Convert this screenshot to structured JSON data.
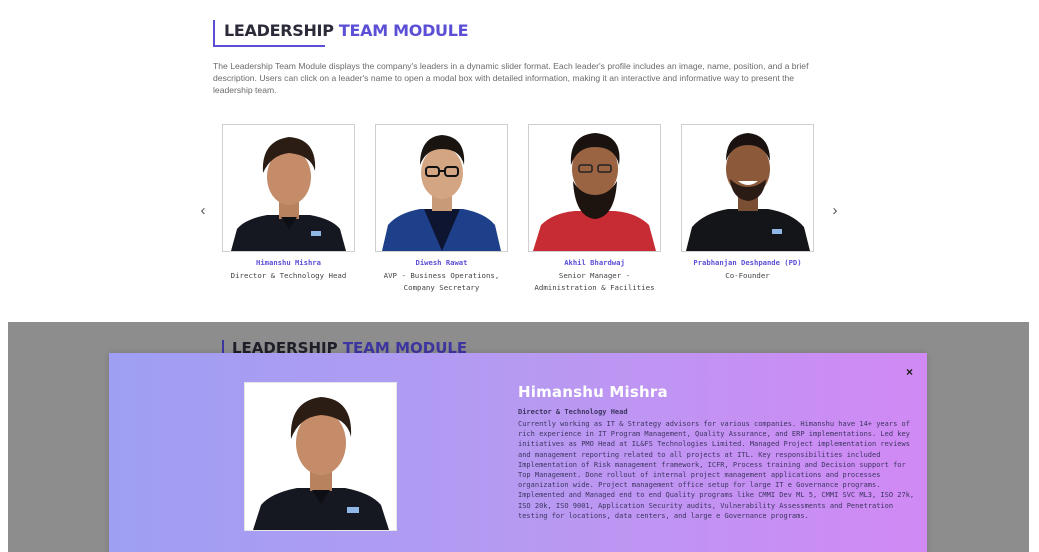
{
  "section": {
    "heading_dark": "LEADERSHIP",
    "heading_accent": "TEAM MODULE",
    "description": "The Leadership Team Module displays the company's leaders in a dynamic slider format. Each leader's profile includes an image, name, position, and a brief description. Users can click on a leader's name to open a modal box with detailed information, making it an interactive and informative way to present the leadership team."
  },
  "slider": {
    "prev_icon": "chevron-left-icon",
    "next_icon": "chevron-right-icon",
    "prev_glyph": "‹",
    "next_glyph": "›"
  },
  "leaders": [
    {
      "name": "Himanshu Mishra",
      "role": "Director & Technology Head"
    },
    {
      "name": "Diwesh Rawat",
      "role": "AVP - Business Operations, Company Secretary"
    },
    {
      "name": "Akhil Bhardwaj",
      "role": "Senior Manager - Administration & Facilities"
    },
    {
      "name": "Prabhanjan Deshpande (PD)",
      "role": "Co-Founder"
    }
  ],
  "modal": {
    "close_glyph": "×",
    "name": "Himanshu Mishra",
    "role": "Director & Technology Head",
    "bio": "Currently working as IT & Strategy advisors for various companies. Himanshu have 14+ years of rich experience in IT Program Management, Quality Assurance, and ERP implementations. Led key initiatives as PMO Head at IL&FS Technologies Limited. Managed Project implementation reviews and management reporting related to all projects at ITL. Key responsibilities included Implementation of Risk management framework, ICFR, Process training and Decision support for Top Management. Done rollout of internal project management applications and processes organization wide. Project management office setup for large IT e Governance programs. Implemented and Managed end to end Quality programs like CMMI Dev ML 5, CMMI SVC ML3, ISO 27k, ISO 20k, ISO 9001, Application Security audits, Vulnerability Assessments and Penetration testing for locations, data centers, and large e Governance programs."
  },
  "colors": {
    "accent": "#5b4fd6",
    "overlay": "#8d8d8d",
    "modal_gradient_start": "#9e9ff3",
    "modal_gradient_end": "#d189f4"
  }
}
